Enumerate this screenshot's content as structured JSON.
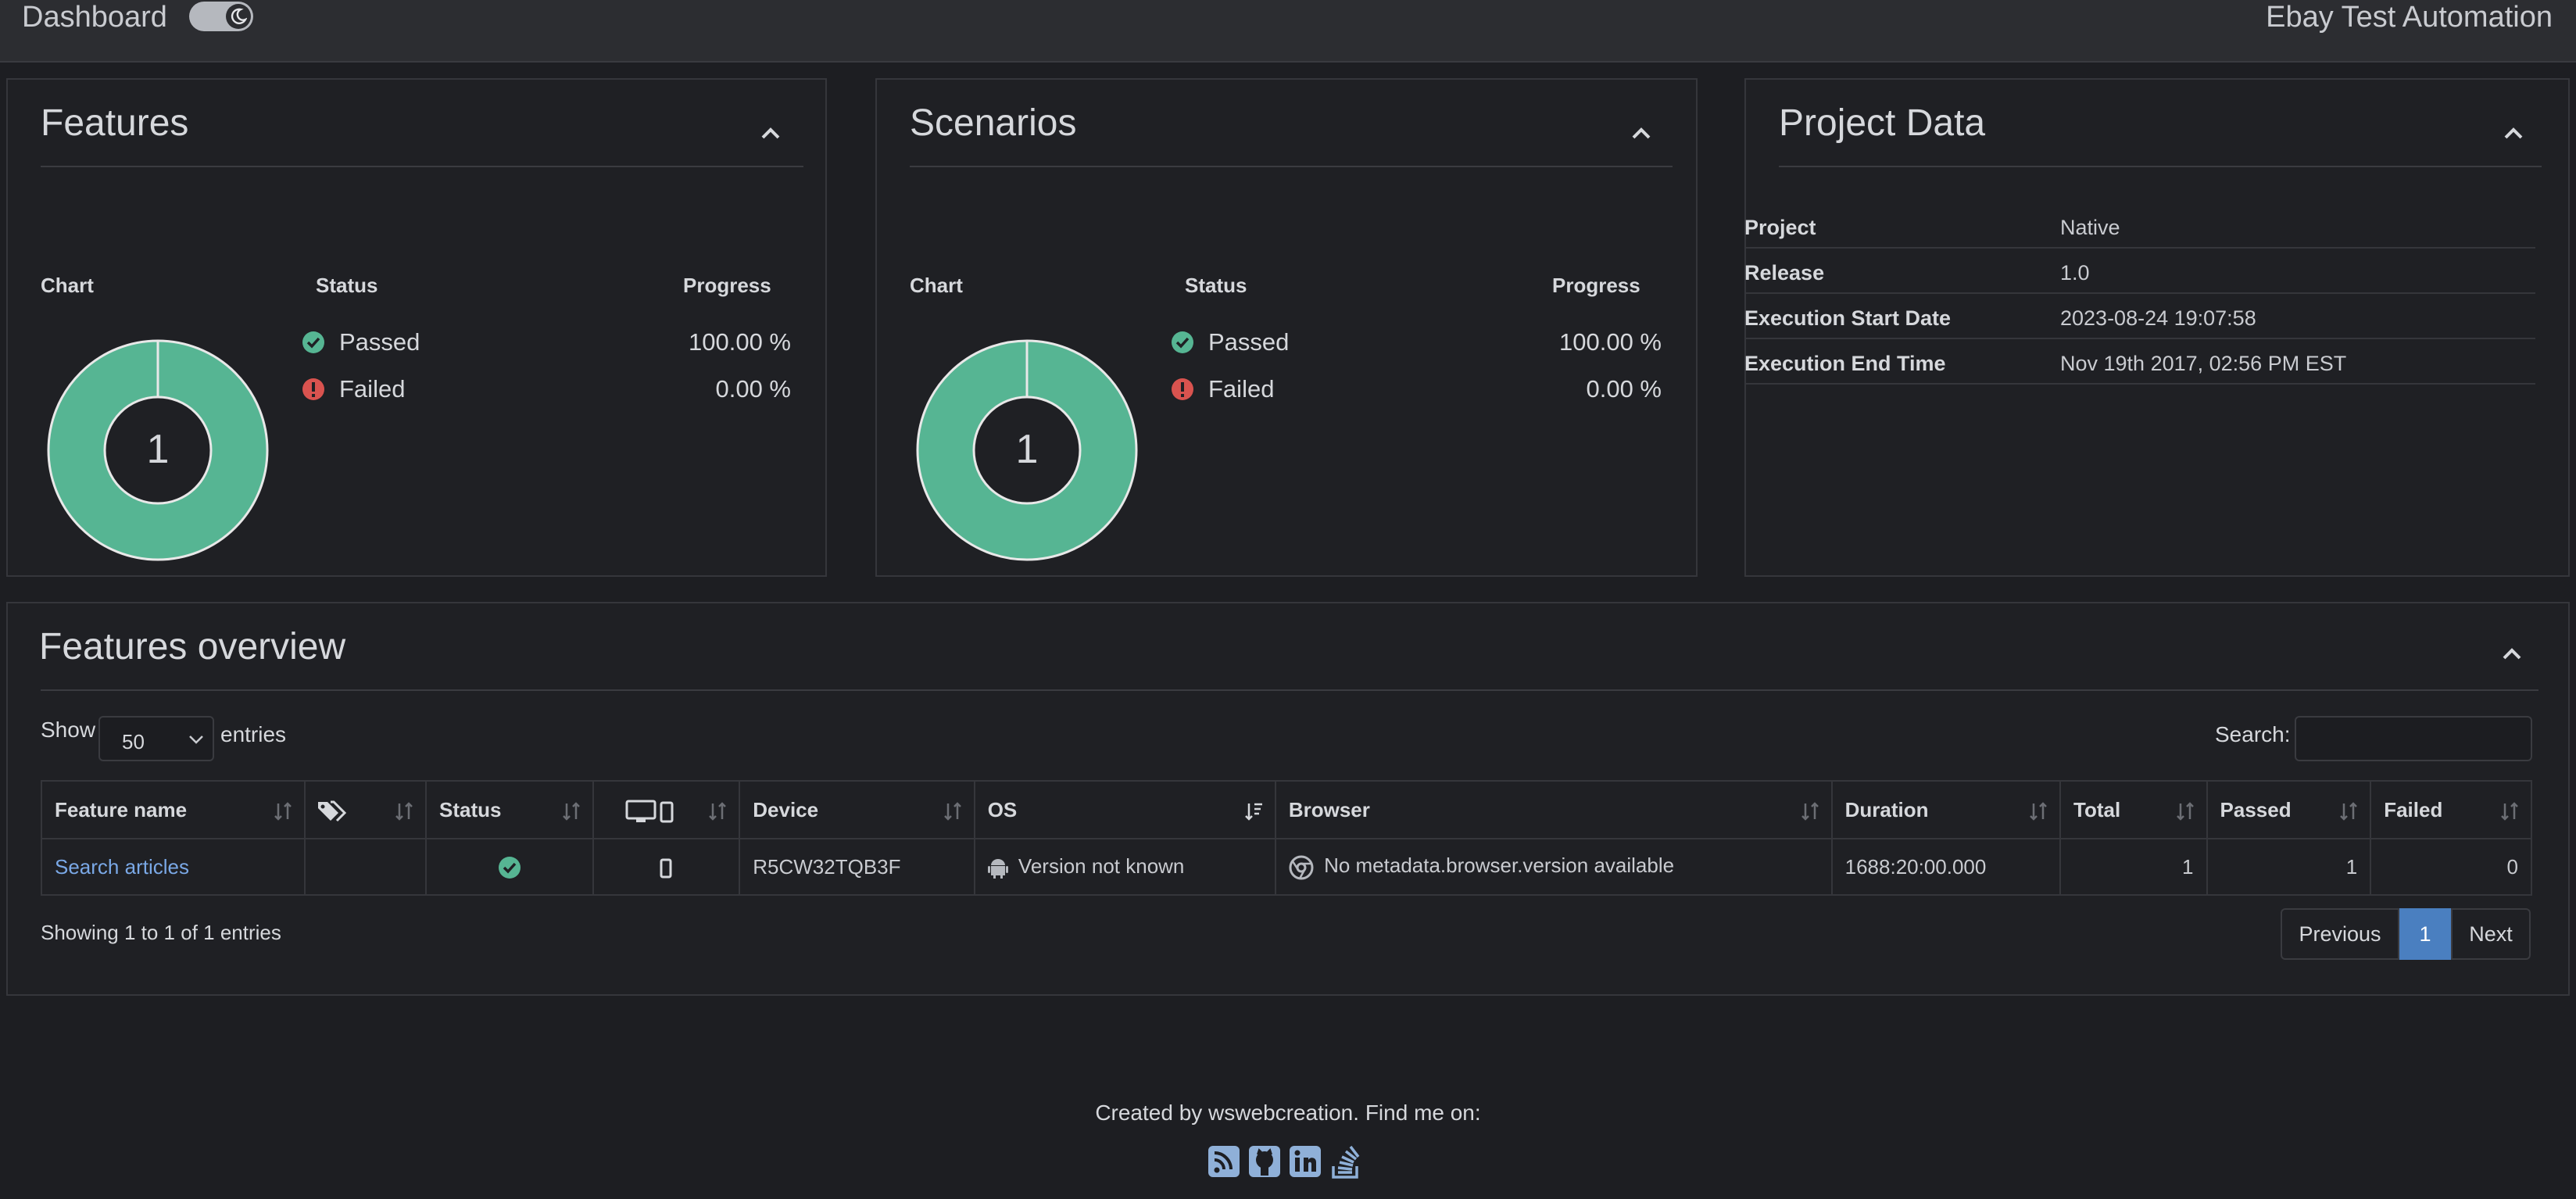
{
  "navbar": {
    "title": "Dashboard",
    "theme_toggle_icon": "moon-icon",
    "project_title": "Ebay Test Automation"
  },
  "features_panel": {
    "title": "Features",
    "col_chart": "Chart",
    "col_status": "Status",
    "col_progress": "Progress",
    "donut_count": "1",
    "rows": [
      {
        "label": "Passed",
        "value": "100.00 %",
        "color": "#56b593"
      },
      {
        "label": "Failed",
        "value": "0.00 %",
        "color": "#d9534f"
      }
    ]
  },
  "scenarios_panel": {
    "title": "Scenarios",
    "col_chart": "Chart",
    "col_status": "Status",
    "col_progress": "Progress",
    "donut_count": "1",
    "rows": [
      {
        "label": "Passed",
        "value": "100.00 %",
        "color": "#56b593"
      },
      {
        "label": "Failed",
        "value": "0.00 %",
        "color": "#d9534f"
      }
    ]
  },
  "project_data": {
    "title": "Project Data",
    "rows": [
      {
        "key": "Project",
        "value": "Native"
      },
      {
        "key": "Release",
        "value": "1.0"
      },
      {
        "key": "Execution Start Date",
        "value": "2023-08-24 19:07:58"
      },
      {
        "key": "Execution End Time",
        "value": "Nov 19th 2017, 02:56 PM EST"
      }
    ]
  },
  "overview": {
    "title": "Features overview",
    "show_label": "Show",
    "page_size": "50",
    "entries_label": "entries",
    "search_label": "Search:",
    "columns": {
      "feature_name": "Feature name",
      "status": "Status",
      "device": "Device",
      "os": "OS",
      "browser": "Browser",
      "duration": "Duration",
      "total": "Total",
      "passed": "Passed",
      "failed": "Failed"
    },
    "row": {
      "feature_name": "Search articles",
      "device": "R5CW32TQB3F",
      "os": "Version not known",
      "browser": "No metadata.browser.version available",
      "duration": "1688:20:00.000",
      "total": "1",
      "passed": "1",
      "failed": "0"
    },
    "showing": "Showing 1 to 1 of 1 entries",
    "pager": {
      "previous": "Previous",
      "current": "1",
      "next": "Next"
    }
  },
  "footer": {
    "text": "Created by wswebcreation. Find me on:",
    "icons": [
      "rss-icon",
      "github-icon",
      "linkedin-icon",
      "stackoverflow-icon"
    ]
  },
  "colors": {
    "passed": "#56b593",
    "failed": "#d9534f",
    "accent": "#4a7fc0"
  }
}
